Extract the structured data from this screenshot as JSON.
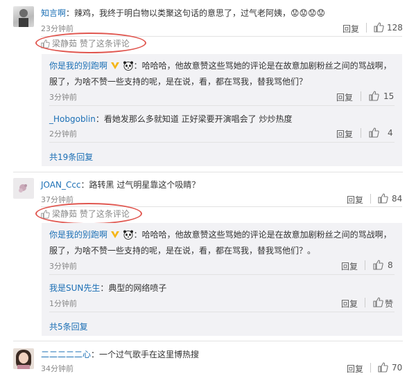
{
  "comments": [
    {
      "user": "知言啊",
      "text": "：辣鸡，我终于明白物以类聚这句话的意思了，过气老阿姨，😟😟😟😟",
      "time": "23分钟前",
      "reply_label": "回复",
      "likes": "128",
      "liked_by": "梁静茹 赞了这条评论",
      "replies": [
        {
          "user": "你是我的别跑啊",
          "text_line1": "：哈哈哈，他故意赞这些骂她的评论是在故意加剧粉丝之间的骂战啊，",
          "text_line2": "服了，为啥不赞一些支持的呢，是在说，看，都在骂我，替我骂他们？",
          "time": "3分钟前",
          "reply_label": "回复",
          "likes": "15"
        },
        {
          "user": "_Hobgoblin",
          "text": "：看她发那么多就知道 正好梁要开演唱会了 炒炒热度",
          "time": "2分钟前",
          "reply_label": "回复",
          "likes": "4"
        }
      ],
      "more": "共19条回复"
    },
    {
      "user": "JOAN_Ccc",
      "text": "：路转黑 过气明星靠这个吸睛？",
      "time": "37分钟前",
      "reply_label": "回复",
      "likes": "84",
      "liked_by": "梁静茹 赞了这条评论",
      "replies": [
        {
          "user": "你是我的别跑啊",
          "text_line1": "：哈哈哈，他故意赞这些骂她的评论是在故意加剧粉丝之间的骂战啊，",
          "text_line2": "服了，为啥不赞一些支持的呢，是在说，看，都在骂我，替我骂他们？。",
          "time": "3分钟前",
          "reply_label": "回复",
          "likes": "8"
        },
        {
          "user": "我是SUN先生",
          "text": "：典型的网络喷子",
          "time": "1分钟前",
          "reply_label": "回复",
          "likes": "赞"
        }
      ],
      "more": "共5条回复"
    },
    {
      "user": "二二二二二心",
      "text": "：一个过气歌手在这里博热搜",
      "time": "34分钟前",
      "reply_label": "回复",
      "likes": "70"
    }
  ],
  "colors": {
    "link": "#1b6fb5",
    "highlight": "#e0564f",
    "reply_bg": "#f2f2f5"
  }
}
